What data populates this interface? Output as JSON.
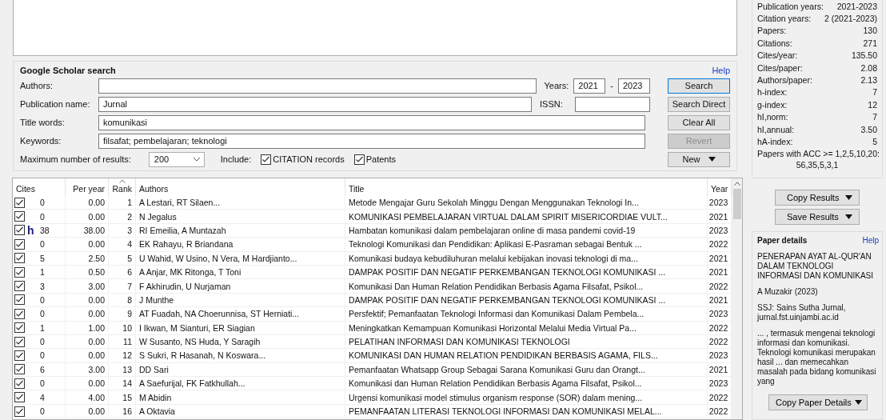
{
  "search": {
    "title": "Google Scholar search",
    "help": "Help",
    "fields": [
      {
        "label": "Authors:"
      },
      {
        "label": "Publication name:",
        "value": "Jurnal"
      },
      {
        "label": "Title words:",
        "value": "komunikasi"
      },
      {
        "label": "Keywords:",
        "value": "filsafat; pembelajaran; teknologi"
      }
    ],
    "years": {
      "label": "Years:",
      "from": "2021",
      "separator": "-",
      "to": "2023"
    },
    "issn": {
      "label": "ISSN:"
    },
    "max_results": {
      "label": "Maximum number of results:",
      "value": "200"
    },
    "include": {
      "label": "Include:",
      "options": [
        {
          "label": "CITATION records",
          "checked": true
        },
        {
          "label": "Patents",
          "checked": true
        }
      ]
    },
    "buttons": [
      {
        "label": "Search",
        "kind": "default",
        "disabled": false
      },
      {
        "label": "Search Direct",
        "kind": "plain",
        "disabled": false
      },
      {
        "label": "Clear All",
        "kind": "plain",
        "disabled": false
      },
      {
        "label": "Revert",
        "kind": "plain",
        "disabled": true
      },
      {
        "label": "New",
        "kind": "menu",
        "disabled": false
      }
    ]
  },
  "table": {
    "columns": [
      {
        "label": "Cites",
        "sorted": false
      },
      {
        "label": "Per year",
        "sorted": false
      },
      {
        "label": "Rank",
        "sorted": true
      },
      {
        "label": "Authors",
        "sorted": false
      },
      {
        "label": "Title",
        "sorted": false
      },
      {
        "label": "Year",
        "sorted": false
      }
    ],
    "rows": [
      {
        "checked": true,
        "cites": "0",
        "per_year": "0.00",
        "rank": "1",
        "authors": "A Lestari, RT Silaen...",
        "title": "Metode Mengajar Guru Sekolah Minggu Dengan Menggunakan Teknologi In...",
        "year": "2023"
      },
      {
        "checked": true,
        "cites": "0",
        "per_year": "0.00",
        "rank": "2",
        "authors": "N Jegalus",
        "title": "KOMUNIKASI PEMBELAJARAN VIRTUAL DALAM SPIRIT MISERICORDIAE VULT...",
        "year": "2021"
      },
      {
        "checked": true,
        "marker": "h",
        "cites": "38",
        "per_year": "38.00",
        "rank": "3",
        "authors": "RI Emeilia, A Muntazah",
        "title": "Hambatan komunikasi dalam pembelajaran online di masa pandemi covid-19",
        "year": "2023"
      },
      {
        "checked": true,
        "cites": "0",
        "per_year": "0.00",
        "rank": "4",
        "authors": "EK Rahayu, R Briandana",
        "title": "Teknologi Komunikasi dan Pendidikan: Aplikasi E-Pasraman sebagai Bentuk ...",
        "year": "2022"
      },
      {
        "checked": true,
        "cites": "5",
        "per_year": "2.50",
        "rank": "5",
        "authors": "U Wahid, W Usino, N Vera, M Hardjianto...",
        "title": "Komunikasi budaya kebudiluhuran melalui kebijakan inovasi teknologi di ma...",
        "year": "2021"
      },
      {
        "checked": true,
        "cites": "1",
        "per_year": "0.50",
        "rank": "6",
        "authors": "A Anjar, MK Ritonga, T Toni",
        "title": "DAMPAK POSITIF DAN NEGATIF PERKEMBANGAN TEKNOLOGI KOMUNIKASI ...",
        "year": "2021"
      },
      {
        "checked": true,
        "cites": "3",
        "per_year": "3.00",
        "rank": "7",
        "authors": "F Akhirudin, U Nurjaman",
        "title": "Komunikasi Dan Human Relation Pendidikan Berbasis Agama Filsafat, Psikol...",
        "year": "2022"
      },
      {
        "checked": true,
        "cites": "0",
        "per_year": "0.00",
        "rank": "8",
        "authors": "J Munthe",
        "title": "DAMPAK POSITIF DAN NEGATIF PERKEMBANGAN TEKNOLOGI KOMUNIKASI ...",
        "year": "2021"
      },
      {
        "checked": true,
        "cites": "0",
        "per_year": "0.00",
        "rank": "9",
        "authors": "AT Fuadah, NA Choerunnisa, ST Herniati...",
        "title": "Persfektif; Pemanfaatan Teknologi Informasi dan Komunikasi Dalam Pembela...",
        "year": "2023"
      },
      {
        "checked": true,
        "cites": "1",
        "per_year": "1.00",
        "rank": "10",
        "authors": "I Ikwan, M Sianturi, ER Siagian",
        "title": "Meningkatkan Kemampuan Komunikasi Horizontal Melalui Media Virtual Pa...",
        "year": "2022"
      },
      {
        "checked": true,
        "cites": "0",
        "per_year": "0.00",
        "rank": "11",
        "authors": "W Susanto, NS Huda, Y Saragih",
        "title": "PELATIHAN INFORMASI DAN KOMUNIKASI TEKNOLOGI",
        "year": "2022"
      },
      {
        "checked": true,
        "cites": "0",
        "per_year": "0.00",
        "rank": "12",
        "authors": "S Sukri, R Hasanah, N Koswara...",
        "title": "KOMUNIKASI DAN HUMAN RELATION PENDIDIKAN BERBASIS AGAMA, FILS...",
        "year": "2023"
      },
      {
        "checked": true,
        "cites": "6",
        "per_year": "3.00",
        "rank": "13",
        "authors": "DD Sari",
        "title": "Pemanfaatan Whatsapp Group Sebagai Sarana Komunikasi Guru dan Orangt...",
        "year": "2021"
      },
      {
        "checked": true,
        "cites": "0",
        "per_year": "0.00",
        "rank": "14",
        "authors": "A Saefurijal, FK Fatkhullah...",
        "title": "Komunikasi dan Human Relation Pendidikan Berbasis Agama Filsafat, Psikol...",
        "year": "2023"
      },
      {
        "checked": true,
        "cites": "4",
        "per_year": "4.00",
        "rank": "15",
        "authors": "M Abidin",
        "title": "Urgensi komunikasi model stimulus organism response (SOR) dalam mening...",
        "year": "2022"
      },
      {
        "checked": true,
        "cites": "0",
        "per_year": "0.00",
        "rank": "16",
        "authors": "A Oktavia",
        "title": "PEMANFAATAN LITERASI TEKNOLOGI INFORMASI DAN KOMUNIKASI MELAL...",
        "year": "2022"
      }
    ]
  },
  "metrics": [
    {
      "label": "Publication years:",
      "value": "2021-2023"
    },
    {
      "label": "Citation years:",
      "value": "2 (2021-2023)"
    },
    {
      "label": "Papers:",
      "value": "130"
    },
    {
      "label": "Citations:",
      "value": "271"
    },
    {
      "label": "Cites/year:",
      "value": "135.50"
    },
    {
      "label": "Cites/paper:",
      "value": "2.08"
    },
    {
      "label": "Authors/paper:",
      "value": "2.13"
    },
    {
      "label": "h-index:",
      "value": "7"
    },
    {
      "label": "g-index:",
      "value": "12"
    },
    {
      "label": "hI,norm:",
      "value": "7"
    },
    {
      "label": "hI,annual:",
      "value": "3.50"
    },
    {
      "label": "hA-index:",
      "value": "5"
    }
  ],
  "acc": {
    "label": "Papers with ACC >= 1,2,5,10,20:",
    "value": "56,35,5,3,1"
  },
  "result_buttons": [
    "Copy Results",
    "Save Results"
  ],
  "paper_details": {
    "title": "Paper details",
    "help": "Help",
    "paper_title": "PENERAPAN AYAT AL-QUR'AN DALAM TEKNOLOGI INFORMASI DAN KOMUNIKASI",
    "authors": "A Muzakir (2023)",
    "source": "SSJ: Sains Sutha Jurnal, jurnal.fst.uinjambi.ac.id",
    "abstract": "... , termasuk mengenai teknologi informasi dan komunikasi. Teknologi komunikasi merupakan hasil ... dan memecahkan masalah pada bidang komunikasi yang",
    "button": "Copy Paper Details"
  }
}
